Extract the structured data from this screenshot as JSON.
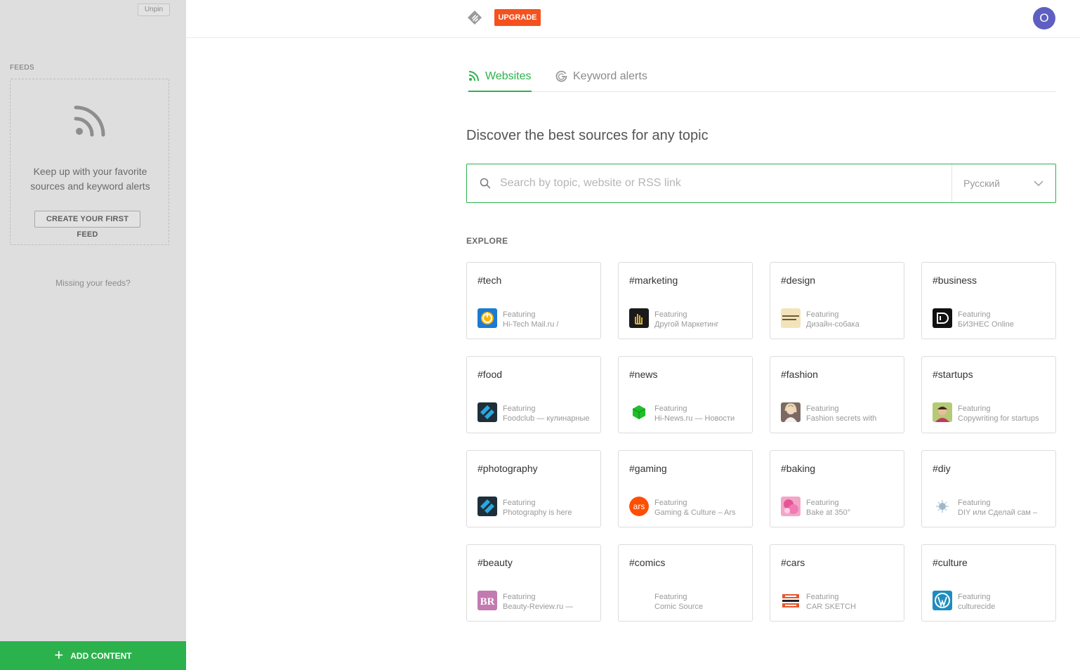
{
  "sidebar": {
    "unpin_label": "Unpin",
    "feeds_label": "FEEDS",
    "empty_line1": "Keep up with your favorite",
    "empty_line2": "sources and keyword alerts",
    "create_label": "CREATE YOUR FIRST FEED",
    "missing_label": "Missing your feeds?",
    "add_content_label": "ADD CONTENT"
  },
  "header": {
    "upgrade_label": "UPGRADE",
    "avatar_initial": "O"
  },
  "tabs": [
    {
      "label": "Websites",
      "active": true
    },
    {
      "label": "Keyword alerts",
      "active": false
    }
  ],
  "main": {
    "heading": "Discover the best sources for any topic",
    "search_placeholder": "Search by topic, website or RSS link",
    "language": "Русский",
    "explore_label": "EXPLORE"
  },
  "colors": {
    "accent": "#2bb24c",
    "upgrade": "#f4511e",
    "avatar": "#5e5fc1",
    "sidebar_bg": "#dedede"
  },
  "topics": [
    {
      "title": "#tech",
      "featuring": "Featuring",
      "source": "Hi-Tech Mail.ru /",
      "icon": "power-icon"
    },
    {
      "title": "#marketing",
      "featuring": "Featuring",
      "source": "Другой Маркетинг",
      "icon": "hand-icon"
    },
    {
      "title": "#design",
      "featuring": "Featuring",
      "source": "Дизайн-собака",
      "icon": "studio-logo-icon"
    },
    {
      "title": "#business",
      "featuring": "Featuring",
      "source": "БИЗНЕС Online",
      "icon": "business-logo-icon"
    },
    {
      "title": "#food",
      "featuring": "Featuring",
      "source": "Foodclub — кулинарные",
      "icon": "foodclub-icon"
    },
    {
      "title": "#news",
      "featuring": "Featuring",
      "source": "Hi-News.ru — Новости",
      "icon": "cube-icon"
    },
    {
      "title": "#fashion",
      "featuring": "Featuring",
      "source": "Fashion secrets with",
      "icon": "fashion-avatar-icon"
    },
    {
      "title": "#startups",
      "featuring": "Featuring",
      "source": "Copywriting for startups",
      "icon": "startup-avatar-icon"
    },
    {
      "title": "#photography",
      "featuring": "Featuring",
      "source": "Photography is here",
      "icon": "photo-icon"
    },
    {
      "title": "#gaming",
      "featuring": "Featuring",
      "source": "Gaming & Culture – Ars",
      "icon": "ars-icon"
    },
    {
      "title": "#baking",
      "featuring": "Featuring",
      "source": "Bake at 350°",
      "icon": "cookie-icon"
    },
    {
      "title": "#diy",
      "featuring": "Featuring",
      "source": "DIY или Сделай сам –",
      "icon": "splash-icon"
    },
    {
      "title": "#beauty",
      "featuring": "Featuring",
      "source": "Beauty-Review.ru —",
      "icon": "br-logo-icon"
    },
    {
      "title": "#comics",
      "featuring": "Featuring",
      "source": "Comic Source",
      "icon": "blank-icon"
    },
    {
      "title": "#cars",
      "featuring": "Featuring",
      "source": "CAR SKETCH",
      "icon": "car-sketch-icon"
    },
    {
      "title": "#culture",
      "featuring": "Featuring",
      "source": "culturecide",
      "icon": "wordpress-icon"
    }
  ]
}
